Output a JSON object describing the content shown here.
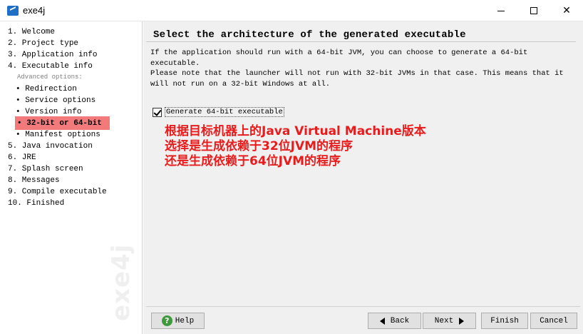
{
  "window": {
    "title": "exe4j",
    "icons": {
      "app": "exe4j-app-icon",
      "minimize": "minimize-icon",
      "maximize": "maximize-icon",
      "close": "close-icon"
    },
    "close_glyph": "✕"
  },
  "sidebar": {
    "steps": [
      {
        "label": "1.  Welcome"
      },
      {
        "label": "2.  Project type"
      },
      {
        "label": "3.  Application info"
      },
      {
        "label": "4.  Executable info"
      }
    ],
    "advanced_hint": "Advanced options:",
    "sub_steps": [
      {
        "label": "• Redirection"
      },
      {
        "label": "• Service options"
      },
      {
        "label": "• Version info"
      },
      {
        "label": "• 32-bit or 64-bit",
        "active": true
      },
      {
        "label": "• Manifest options"
      }
    ],
    "later_steps": [
      {
        "label": "5.  Java invocation"
      },
      {
        "label": "6.  JRE"
      },
      {
        "label": "7.  Splash screen"
      },
      {
        "label": "8.  Messages"
      },
      {
        "label": "9.  Compile executable"
      },
      {
        "label": "10. Finished"
      }
    ],
    "watermark": "exe4j",
    "active_color": "#f27a7a"
  },
  "main": {
    "heading": "Select the architecture of the generated executable",
    "para1": "If the application should run with a 64-bit JVM, you can choose to generate a 64-bit executable.",
    "para2": "Please note that the launcher will not run with 32-bit JVMs in that case. This means that it will not run on a 32-bit Windows at all.",
    "checkbox": {
      "label": "Generate 64-bit executable",
      "checked": true
    },
    "annotation": [
      "根据目标机器上的Java Virtual Machine版本",
      "选择是生成依赖于32位JVM的程序",
      "还是生成依赖于64位JVM的程序"
    ],
    "annotation_color": "#e81c1c"
  },
  "buttons": {
    "help": "Help",
    "help_icon_glyph": "?",
    "back": "Back",
    "next": "Next",
    "finish": "Finish",
    "cancel": "Cancel",
    "icons": {
      "help": "help-icon",
      "back": "arrow-left-icon",
      "next": "arrow-right-icon"
    }
  }
}
